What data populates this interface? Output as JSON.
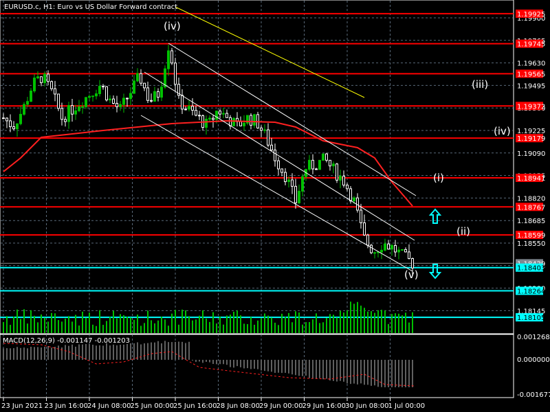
{
  "title": "EURUSD.c, H1:  Euro vs US Dollar Forward contract",
  "macd_label": "MACD(12,26,9) -0.001147 -0.001203",
  "colors": {
    "bull": "#00c000",
    "bear": "#ffffff",
    "level": "#ff0000",
    "support": "#00ffff",
    "ma": "#ff2020",
    "trend": "#ffff00"
  },
  "chart_data": {
    "type": "candlestick",
    "symbol": "EURUSD.c",
    "timeframe": "H1",
    "x_ticks": [
      "23 Jun 2021",
      "23 Jun 16:00",
      "24 Jun 08:00",
      "25 Jun 00:00",
      "25 Jun 16:00",
      "28 Jun 08:00",
      "29 Jun 00:00",
      "29 Jun 16:00",
      "30 Jun 08:00",
      "1 Jul 00:00"
    ],
    "y_ticks": [
      "1.19900",
      "1.19765",
      "1.19630",
      "1.19495",
      "1.19360",
      "1.19225",
      "1.19090",
      "1.18955",
      "1.18820",
      "1.18685",
      "1.18550",
      "1.18415",
      "1.18280",
      "1.18145"
    ],
    "ylim": [
      1.1805,
      1.2005
    ],
    "close_path": [
      1.193,
      1.1925,
      1.1935,
      1.195,
      1.1955,
      1.1945,
      1.193,
      1.1935,
      1.194,
      1.1945,
      1.195,
      1.194,
      1.1935,
      1.1945,
      1.1955,
      1.194,
      1.1945,
      1.1975,
      1.194,
      1.1935,
      1.193,
      1.1925,
      1.1935,
      1.193,
      1.1925,
      1.193,
      1.1928,
      1.1918,
      1.1905,
      1.1895,
      1.188,
      1.19,
      1.1902,
      1.1905,
      1.1898,
      1.1892,
      1.188,
      1.1858,
      1.185,
      1.1855,
      1.1852,
      1.1847,
      1.1843
    ],
    "red_levels": [
      "1.19925",
      "1.19745",
      "1.19565",
      "1.19372",
      "1.19179",
      "1.18941",
      "1.18767",
      "1.18599"
    ],
    "cyan_levels": [
      "1.18403",
      "1.18264",
      "1.18105"
    ],
    "current_price": "1.18429",
    "wave_labels": [
      {
        "text": "(iv)",
        "price": 1.1985
      },
      {
        "text": "(iii)",
        "price": 1.195
      },
      {
        "text": "(iv)",
        "price": 1.1922
      },
      {
        "text": "(i)",
        "price": 1.1894
      },
      {
        "text": "(ii)",
        "price": 1.1862
      },
      {
        "text": "(v)",
        "price": 1.1836
      }
    ],
    "macd_ticks": [
      "0.001268",
      "0.000000",
      "-0.001677"
    ]
  }
}
